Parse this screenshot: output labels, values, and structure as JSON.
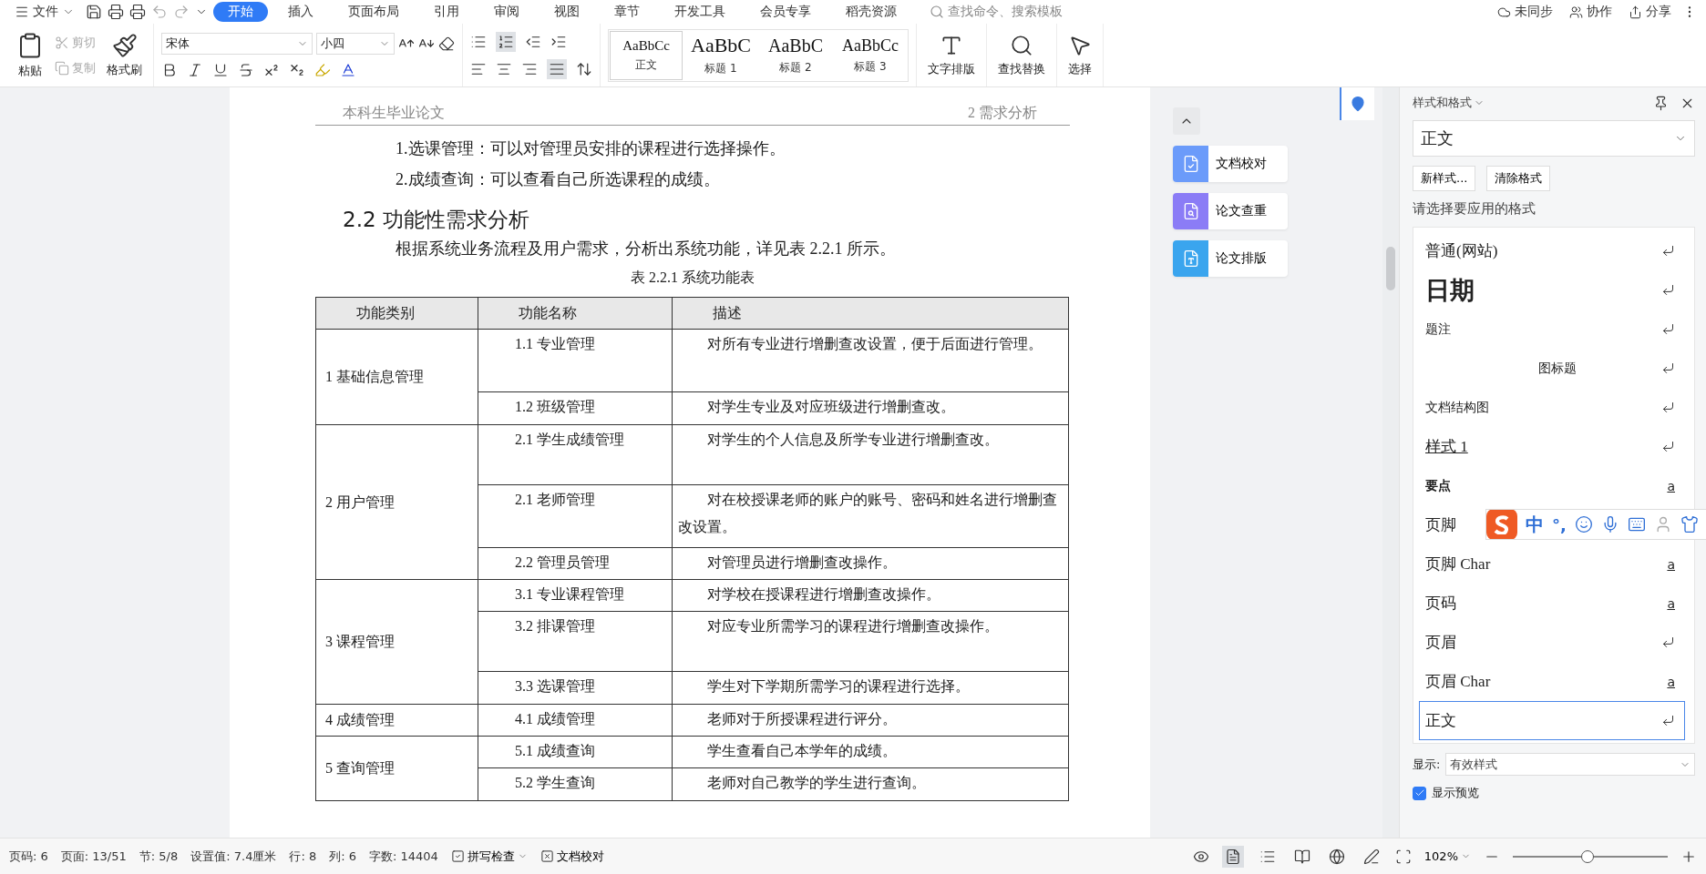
{
  "menu": {
    "file": "文件",
    "tabs": [
      {
        "label": "开始",
        "selected": true
      },
      {
        "label": "插入",
        "selected": false
      },
      {
        "label": "页面布局",
        "selected": false
      },
      {
        "label": "引用",
        "selected": false
      },
      {
        "label": "审阅",
        "selected": false
      },
      {
        "label": "视图",
        "selected": false
      },
      {
        "label": "章节",
        "selected": false
      },
      {
        "label": "开发工具",
        "selected": false
      },
      {
        "label": "会员专享",
        "selected": false
      },
      {
        "label": "稻壳资源",
        "selected": false
      }
    ],
    "search": {
      "placeholder": "查找命令、搜索模板"
    },
    "actions": [
      "未同步",
      "协作",
      "分享"
    ]
  },
  "ribbon": {
    "paste": "粘贴",
    "edit": [
      {
        "label": "剪切",
        "disabled": true
      },
      {
        "label": "复制",
        "disabled": true
      }
    ],
    "painter": "格式刷",
    "font": {
      "name": "宋体",
      "size": "小四"
    },
    "gallery": [
      {
        "preview": "AaBbCc",
        "label": "正文",
        "selected": true
      },
      {
        "preview": "AaBbC",
        "label": "标题 1",
        "selected": false
      },
      {
        "preview": "AaBbC",
        "label": "标题 2",
        "selected": false
      },
      {
        "preview": "AaBbCc",
        "label": "标题 3",
        "selected": false
      }
    ],
    "tools": [
      {
        "label": "文字排版",
        "kind": "layout"
      },
      {
        "label": "查找替换",
        "kind": "find"
      },
      {
        "label": "选择",
        "kind": "select"
      }
    ]
  },
  "document": {
    "header_left": "本科生毕业论文",
    "header_right": "2  需求分析",
    "list": [
      "1.选课管理：可以对管理员安排的课程进行选择操作。",
      "2.成绩查询：可以查看自己所选课程的成绩。"
    ],
    "heading": "2.2  功能性需求分析",
    "paragraph": "根据系统业务流程及用户需求，分析出系统功能，详见表 2.2.1 所示。",
    "caption": "表 2.2.1  系统功能表",
    "table": {
      "columns": [
        "功能类别",
        "功能名称",
        "描述"
      ],
      "groups": [
        {
          "category": "1  基础信息管理",
          "rows": [
            {
              "name": "1.1  专业管理",
              "description": "对所有专业进行增删查改设置，便于后面进行管理。"
            },
            {
              "name": "1.2  班级管理",
              "description": "对学生专业及对应班级进行增删查改。"
            }
          ]
        },
        {
          "category": "2  用户管理",
          "rows": [
            {
              "name": "2.1  学生成绩管理",
              "description": "对学生的个人信息及所学专业进行增删查改。"
            },
            {
              "name": "2.1  老师管理",
              "description": "对在校授课老师的账户的账号、密码和姓名进行增删查改设置。"
            },
            {
              "name": "2.2  管理员管理",
              "description": "对管理员进行增删查改操作。"
            }
          ]
        },
        {
          "category": "3  课程管理",
          "rows": [
            {
              "name": "3.1  专业课程管理",
              "description": "对学校在授课程进行增删查改操作。"
            },
            {
              "name": "3.2  排课管理",
              "description": "对应专业所需学习的课程进行增删查改操作。"
            },
            {
              "name": "3.3  选课管理",
              "description": "学生对下学期所需学习的课程进行选择。"
            }
          ]
        },
        {
          "category": "4  成绩管理",
          "rows": [
            {
              "name": "4.1  成绩管理",
              "description": "老师对于所授课程进行评分。"
            }
          ]
        },
        {
          "category": "5  查询管理",
          "rows": [
            {
              "name": "5.1  成绩查询",
              "description": "学生查看自己本学年的成绩。"
            },
            {
              "name": "5.2  学生查询",
              "description": "老师对自己教学的学生进行查询。"
            }
          ]
        }
      ]
    }
  },
  "side_tools": [
    {
      "label": "文档校对",
      "color": "#6b9bfa",
      "kind": "check"
    },
    {
      "label": "论文查重",
      "color": "#8b7cf6",
      "kind": "search"
    },
    {
      "label": "论文排版",
      "color": "#3aa5ee",
      "kind": "type"
    }
  ],
  "styles_panel": {
    "title": "样式和格式",
    "current": "正文",
    "buttons": [
      "新样式...",
      "清除格式"
    ],
    "prompt": "请选择要应用的格式",
    "styles": [
      {
        "name": "普通(网站)",
        "serif": true,
        "large": false,
        "bold": false,
        "centered": false,
        "underlined": false,
        "kind": "paragraph",
        "selected": false
      },
      {
        "name": "日期",
        "serif": false,
        "large": true,
        "bold": true,
        "centered": false,
        "underlined": false,
        "kind": "paragraph",
        "selected": false
      },
      {
        "name": "题注",
        "serif": false,
        "large": false,
        "bold": false,
        "centered": false,
        "underlined": false,
        "kind": "paragraph",
        "selected": false
      },
      {
        "name": "图标题",
        "serif": false,
        "large": false,
        "bold": false,
        "centered": true,
        "underlined": false,
        "kind": "paragraph",
        "selected": false
      },
      {
        "name": "文档结构图",
        "serif": false,
        "large": false,
        "bold": false,
        "centered": false,
        "underlined": false,
        "kind": "paragraph",
        "selected": false
      },
      {
        "name": "样式 1",
        "serif": true,
        "large": false,
        "bold": false,
        "centered": false,
        "underlined": true,
        "kind": "paragraph",
        "selected": false
      },
      {
        "name": "要点",
        "serif": false,
        "large": false,
        "bold": true,
        "centered": false,
        "underlined": false,
        "kind": "character",
        "mark": "a",
        "selected": false
      },
      {
        "name": "页脚",
        "serif": true,
        "large": false,
        "bold": false,
        "centered": false,
        "underlined": false,
        "selected": false
      },
      {
        "name": "页脚  Char",
        "serif": true,
        "large": false,
        "bold": false,
        "centered": false,
        "underlined": false,
        "kind": "character",
        "mark": "a",
        "selected": false
      },
      {
        "name": "页码",
        "serif": true,
        "large": false,
        "bold": false,
        "centered": false,
        "underlined": false,
        "kind": "character",
        "mark": "a",
        "selected": false
      },
      {
        "name": "页眉",
        "serif": true,
        "large": false,
        "bold": false,
        "centered": false,
        "underlined": false,
        "kind": "paragraph",
        "selected": false
      },
      {
        "name": "页眉  Char",
        "serif": true,
        "large": false,
        "bold": false,
        "centered": false,
        "underlined": false,
        "kind": "character",
        "mark": "a",
        "selected": false
      },
      {
        "name": "正文",
        "serif": true,
        "large": false,
        "bold": false,
        "centered": false,
        "underlined": false,
        "kind": "paragraph",
        "selected": true
      }
    ],
    "display": {
      "label": "显示:",
      "value": "有效样式"
    },
    "preview": {
      "label": "显示预览",
      "checked": true
    }
  },
  "ime": {
    "mode": "中",
    "punctuation": "°,"
  },
  "status": {
    "items": [
      "页码: 6",
      "页面: 13/51",
      "节: 5/8",
      "设置值: 7.4厘米",
      "行: 8",
      "列: 6",
      "字数: 14404"
    ],
    "spell": "拼写检查",
    "proof": "文档校对",
    "views": [
      {
        "kind": "page",
        "selected": true
      },
      {
        "kind": "outline",
        "selected": false
      },
      {
        "kind": "read",
        "selected": false
      },
      {
        "kind": "web",
        "selected": false
      },
      {
        "kind": "write",
        "selected": false
      }
    ],
    "zoom": "102%",
    "zoom_slider": {
      "level": 0.48
    }
  }
}
